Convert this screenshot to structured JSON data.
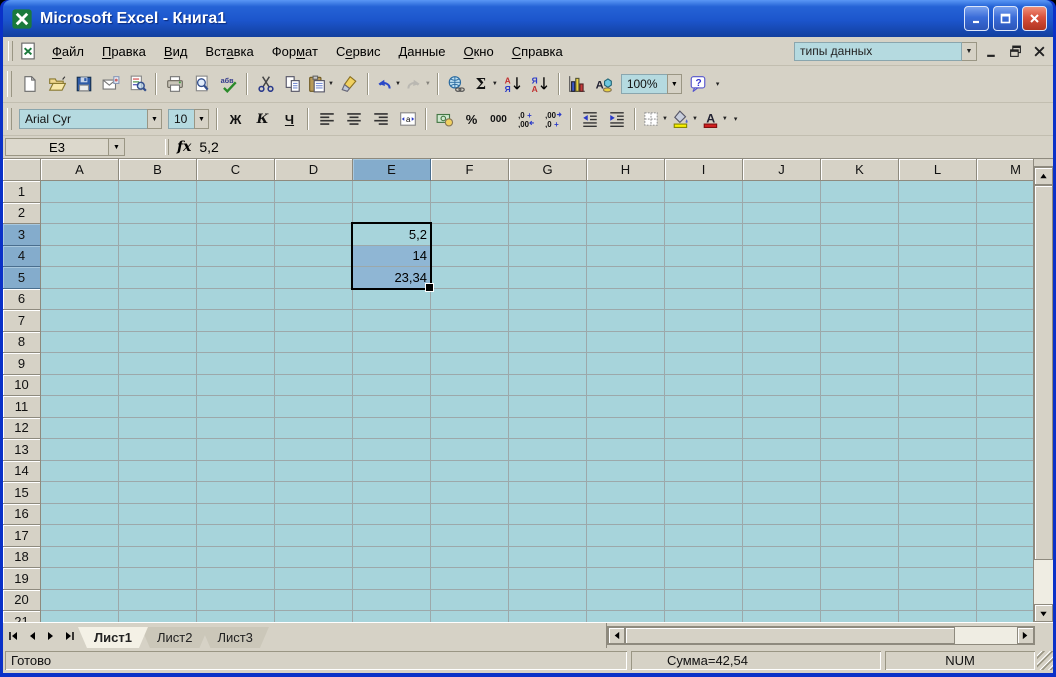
{
  "window": {
    "title": "Microsoft Excel - Книга1"
  },
  "menu_bar": {
    "items": [
      {
        "label": "Файл",
        "u": 0
      },
      {
        "label": "Правка",
        "u": 0
      },
      {
        "label": "Вид",
        "u": 0
      },
      {
        "label": "Вставка",
        "u": 3
      },
      {
        "label": "Формат",
        "u": 3
      },
      {
        "label": "Сервис",
        "u": 1
      },
      {
        "label": "Данные",
        "u": 0
      },
      {
        "label": "Окно",
        "u": 0
      },
      {
        "label": "Справка",
        "u": 0
      }
    ],
    "question_box_value": "типы данных"
  },
  "standard_toolbar": {
    "zoom_value": "100%",
    "items": [
      {
        "name": "new"
      },
      {
        "name": "open"
      },
      {
        "name": "save"
      },
      {
        "name": "mail"
      },
      {
        "name": "search"
      },
      {
        "name": "sep"
      },
      {
        "name": "print"
      },
      {
        "name": "print-preview"
      },
      {
        "name": "spelling"
      },
      {
        "name": "sep"
      },
      {
        "name": "cut"
      },
      {
        "name": "copy"
      },
      {
        "name": "paste",
        "dd": true
      },
      {
        "name": "format-painter"
      },
      {
        "name": "sep"
      },
      {
        "name": "undo",
        "dd": true
      },
      {
        "name": "redo",
        "dd": true,
        "disabled": true
      },
      {
        "name": "sep"
      },
      {
        "name": "hyperlink"
      },
      {
        "name": "autosum",
        "dd": true
      },
      {
        "name": "sort-ascending"
      },
      {
        "name": "sort-descending"
      },
      {
        "name": "sep"
      },
      {
        "name": "chart-wizard"
      },
      {
        "name": "drawing"
      },
      {
        "name": "zoom-combo"
      },
      {
        "name": "help"
      },
      {
        "name": "chevron"
      }
    ]
  },
  "formatting_toolbar": {
    "font_name": "Arial Cyr",
    "font_size": "10",
    "items": [
      {
        "name": "font-combo"
      },
      {
        "name": "size-combo"
      },
      {
        "name": "sep"
      },
      {
        "name": "bold"
      },
      {
        "name": "italic"
      },
      {
        "name": "underline"
      },
      {
        "name": "sep"
      },
      {
        "name": "align-left"
      },
      {
        "name": "align-center"
      },
      {
        "name": "align-right"
      },
      {
        "name": "merge-center"
      },
      {
        "name": "sep"
      },
      {
        "name": "currency"
      },
      {
        "name": "percent"
      },
      {
        "name": "comma-style"
      },
      {
        "name": "increase-decimal"
      },
      {
        "name": "decrease-decimal"
      },
      {
        "name": "sep"
      },
      {
        "name": "decrease-indent"
      },
      {
        "name": "increase-indent"
      },
      {
        "name": "sep"
      },
      {
        "name": "borders",
        "dd": true
      },
      {
        "name": "fill-color",
        "dd": true
      },
      {
        "name": "font-color",
        "dd": true
      },
      {
        "name": "chevron"
      }
    ]
  },
  "icon_labels": {
    "bold": "Ж",
    "italic": "К",
    "underline": "Ч",
    "autosum": "Σ",
    "percent": "%",
    "comma_style": "000",
    "sort_first": "А",
    "sort_last": "Я",
    "help": "?",
    "spelling": "абв"
  },
  "formula_bar": {
    "cell_reference": "E3",
    "function_symbol": "fx",
    "value": "5,2"
  },
  "grid": {
    "column_headers": [
      "A",
      "B",
      "C",
      "D",
      "E",
      "F",
      "G",
      "H",
      "I",
      "J",
      "K",
      "L",
      "M"
    ],
    "row_count": 21,
    "selected_column": "E",
    "selected_rows": [
      3,
      4,
      5
    ],
    "selection_range": "E3:E5",
    "active_cell": "E3",
    "cells": [
      {
        "ref": "E3",
        "col": "E",
        "row": 3,
        "value": "5,2"
      },
      {
        "ref": "E4",
        "col": "E",
        "row": 4,
        "value": "14"
      },
      {
        "ref": "E5",
        "col": "E",
        "row": 5,
        "value": "23,34"
      }
    ]
  },
  "sheet_tab_bar": {
    "tabs": [
      {
        "label": "Лист1",
        "active": true
      },
      {
        "label": "Лист2",
        "active": false
      },
      {
        "label": "Лист3",
        "active": false
      }
    ]
  },
  "status_bar": {
    "mode": "Готово",
    "summary": "Сумма=42,54",
    "keyboard": "NUM"
  },
  "colors": {
    "titlebar_blue": "#1C55CC",
    "window_border": "#0A31C8",
    "toolbar_background": "#D6D2C6",
    "combo_background": "#B5DAE0",
    "sheet_background": "#A7D4DB",
    "gridline": "#9CA8AA",
    "selection_fill": "#8FB6D4",
    "header_selected": "#84ACCC",
    "close_button_red": "#D8503C"
  }
}
